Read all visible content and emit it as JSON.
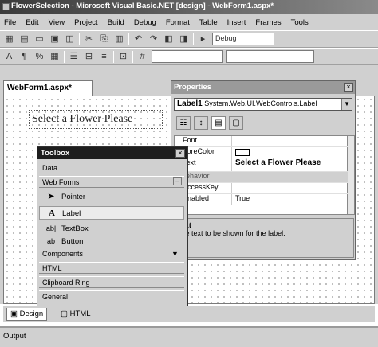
{
  "window": {
    "title": "FlowerSelection - Microsoft Visual Basic.NET [design] - WebForm1.aspx*"
  },
  "menu": [
    "File",
    "Edit",
    "View",
    "Project",
    "Build",
    "Debug",
    "Format",
    "Table",
    "Insert",
    "Frames",
    "Tools"
  ],
  "toolbar1": {
    "config_value": "Debug"
  },
  "document": {
    "tab_label": "WebForm1.aspx*",
    "label_text": "Select a Flower Please"
  },
  "properties": {
    "title": "Properties",
    "object_name": "Label1",
    "object_type": "System.Web.UI.WebControls.Label",
    "rows": [
      {
        "name": "Font",
        "value": "",
        "type": "prop"
      },
      {
        "name": "ForeColor",
        "value": "",
        "type": "color"
      },
      {
        "name": "Text",
        "value": "Select a Flower Please",
        "type": "bold"
      },
      {
        "name": "Behavior",
        "value": "",
        "type": "category"
      },
      {
        "name": "AccessKey",
        "value": "",
        "type": "prop"
      },
      {
        "name": "Enabled",
        "value": "True",
        "type": "prop"
      }
    ],
    "desc_title": "Text",
    "desc_text": "The text to be shown for the label."
  },
  "toolbox": {
    "title": "Toolbox",
    "sections_top": [
      "Data",
      "Web Forms"
    ],
    "items": [
      {
        "label": "Pointer",
        "icon": "pointer-icon"
      },
      {
        "label": "Label",
        "icon": "label-icon"
      },
      {
        "label": "TextBox",
        "icon": "textbox-icon"
      },
      {
        "label": "Button",
        "icon": "button-icon"
      }
    ],
    "sections_bottom": [
      "Components",
      "HTML",
      "Clipboard Ring",
      "General"
    ]
  },
  "view_tabs": [
    "Design",
    "HTML"
  ],
  "output": {
    "label": "Output"
  }
}
